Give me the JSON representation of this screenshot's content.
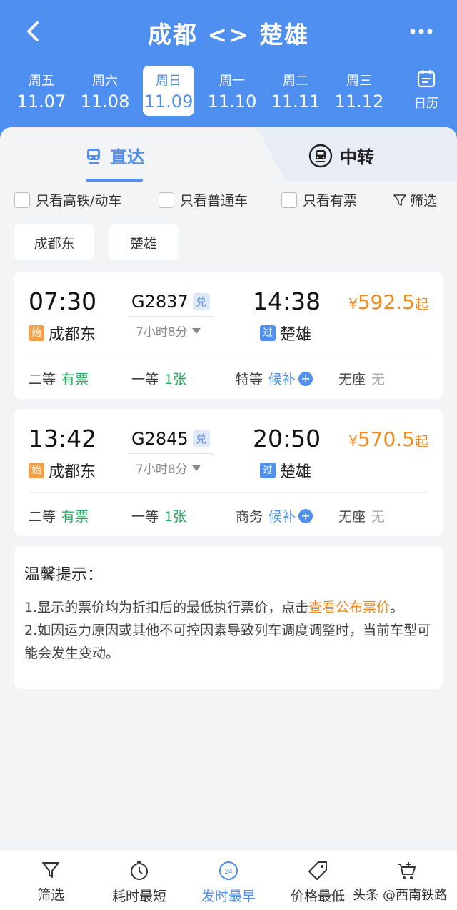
{
  "header": {
    "title": "成都 <> 楚雄",
    "dates": [
      {
        "weekday": "周五",
        "date": "11.07"
      },
      {
        "weekday": "周六",
        "date": "11.08"
      },
      {
        "weekday": "周日",
        "date": "11.09"
      },
      {
        "weekday": "周一",
        "date": "11.10"
      },
      {
        "weekday": "周二",
        "date": "11.11"
      },
      {
        "weekday": "周三",
        "date": "11.12"
      }
    ],
    "calendar_label": "日历"
  },
  "tabs": {
    "direct": "直达",
    "transfer": "中转"
  },
  "filters": {
    "high_speed": "只看高铁/动车",
    "normal": "只看普通车",
    "available": "只看有票",
    "filter": "筛选"
  },
  "station_chips": [
    "成都东",
    "楚雄"
  ],
  "trains": [
    {
      "dep_time": "07:30",
      "train_no": "G2837",
      "dui": "兑",
      "arr_time": "14:38",
      "duration": "7小时8分",
      "price_yen": "¥",
      "price": "592.5",
      "price_suffix": "起",
      "start_tag": "始",
      "from": "成都东",
      "pass_tag": "过",
      "to": "楚雄",
      "seats": [
        {
          "name": "二等",
          "value": "有票"
        },
        {
          "name": "一等",
          "value": "1张"
        },
        {
          "name": "特等",
          "value": "候补"
        },
        {
          "name": "无座",
          "value": "无"
        }
      ]
    },
    {
      "dep_time": "13:42",
      "train_no": "G2845",
      "dui": "兑",
      "arr_time": "20:50",
      "duration": "7小时8分",
      "price_yen": "¥",
      "price": "570.5",
      "price_suffix": "起",
      "start_tag": "始",
      "from": "成都东",
      "pass_tag": "过",
      "to": "楚雄",
      "seats": [
        {
          "name": "二等",
          "value": "有票"
        },
        {
          "name": "一等",
          "value": "1张"
        },
        {
          "name": "商务",
          "value": "候补"
        },
        {
          "name": "无座",
          "value": "无"
        }
      ]
    }
  ],
  "tips": {
    "title": "温馨提示：",
    "line1_prefix": "1.显示的票价均为折扣后的最低执行票价，点击",
    "line1_link": "查看公布票价",
    "line1_suffix": "。",
    "line2": "2.如因运力原因或其他不可控因素导致列车调度调整时，当前车型可能会发生变动。"
  },
  "bottom_bar": [
    {
      "label": "筛选",
      "icon": "filter-icon"
    },
    {
      "label": "耗时最短",
      "icon": "timer-icon"
    },
    {
      "label": "发时最早",
      "icon": "24h-icon",
      "badge": "24"
    },
    {
      "label": "价格最低",
      "icon": "price-tag-icon"
    },
    {
      "label": "",
      "icon": "cart-icon"
    }
  ],
  "watermark": "头条 @西南铁路",
  "colors": {
    "primary": "#4f8ff0",
    "price": "#f08a1c",
    "available": "#25b05f"
  }
}
